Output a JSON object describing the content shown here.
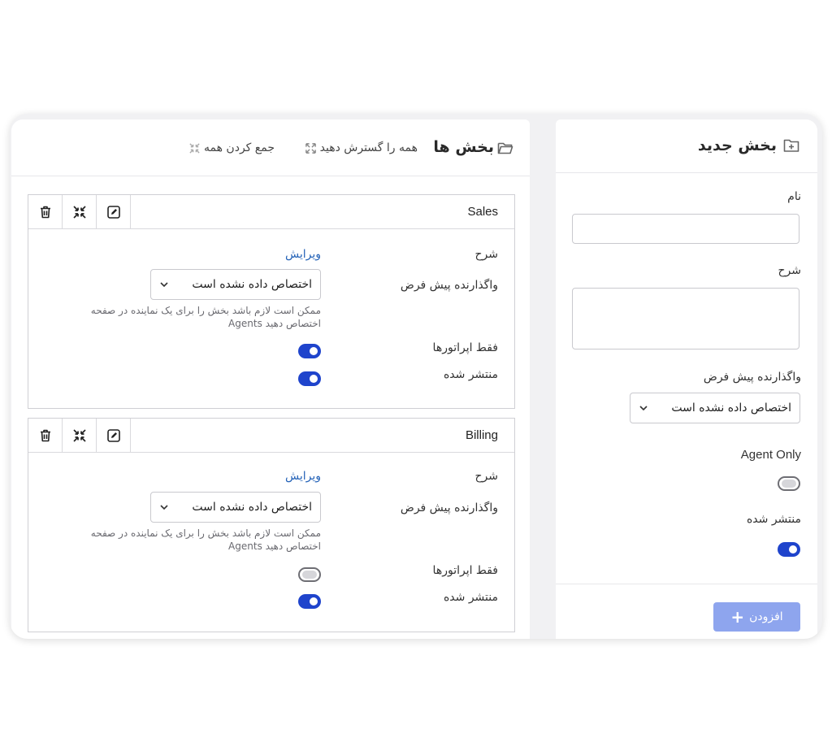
{
  "sections_panel": {
    "title": "بخش ها",
    "expand_all_label": "همه را گسترش دهید",
    "collapse_all_label": "جمع کردن همه"
  },
  "sections": [
    {
      "name": "Sales",
      "description_label": "شرح",
      "edit_link": "ویرایش",
      "default_assigner_label": "واگذارنده پیش فرض",
      "default_assigner_value": "اختصاص داده نشده است",
      "help_line1": "ممکن است لازم باشد بخش را برای یک نماینده در صفحه",
      "help_line2": "Agents اختصاص دهید",
      "operators_only_label": "فقط اپراتورها",
      "operators_only": true,
      "published_label": "منتشر شده",
      "published": true
    },
    {
      "name": "Billing",
      "description_label": "شرح",
      "edit_link": "ویرایش",
      "default_assigner_label": "واگذارنده پیش فرض",
      "default_assigner_value": "اختصاص داده نشده است",
      "help_line1": "ممکن است لازم باشد بخش را برای یک نماینده در صفحه",
      "help_line2": "Agents اختصاص دهید",
      "operators_only_label": "فقط اپراتورها",
      "operators_only": false,
      "published_label": "منتشر شده",
      "published": true
    }
  ],
  "new_section": {
    "title": "بخش جدید",
    "name_label": "نام",
    "name_value": "",
    "description_label": "شرح",
    "description_value": "",
    "default_assigner_label": "واگذارنده پیش فرض",
    "default_assigner_value": "اختصاص داده نشده است",
    "agent_only_label": "Agent Only",
    "agent_only": false,
    "published_label": "منتشر شده",
    "published": true,
    "add_button_label": "افزودن"
  },
  "colors": {
    "accent": "#1f44cc",
    "link": "#2563b8",
    "add_button": "#8ea5ee"
  }
}
